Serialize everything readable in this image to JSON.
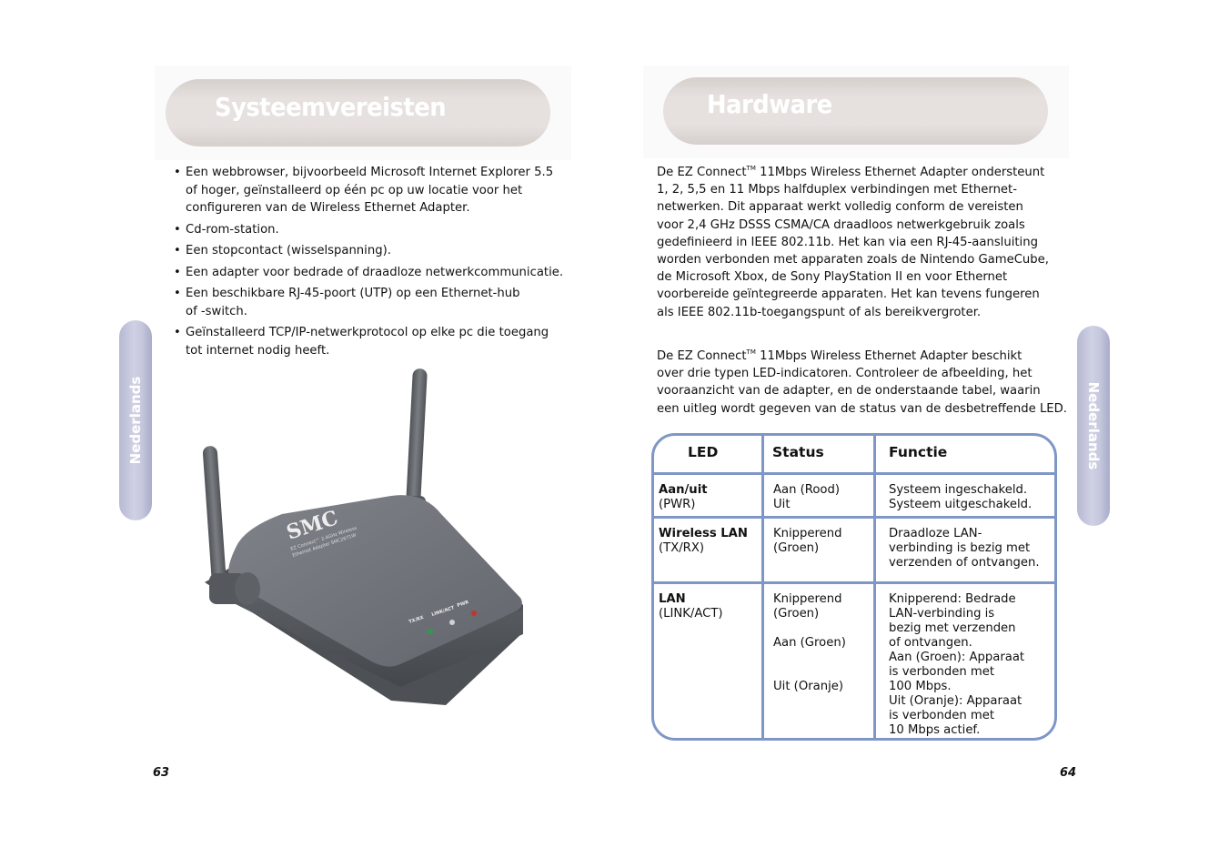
{
  "left_page": {
    "title": "Systeemvereisten",
    "side_tab": "Nederlands",
    "requirements": [
      "Een webbrowser, bijvoorbeeld Microsoft Internet Explorer 5.5 of hoger, geïnstalleerd op één pc op uw locatie voor het configureren van de Wireless Ethernet Adapter.",
      "Cd-rom-station.",
      "Een stopcontact (wisselspanning).",
      "Een adapter voor bedrade of draadloze netwerkcommunicatie.",
      "Een beschikbare RJ-45-poort (UTP) op een Ethernet-hub of -switch.",
      "Geïnstalleerd TCP/IP-netwerkprotocol op elke pc die toegang tot internet nodig heeft."
    ],
    "requirements_lines": [
      [
        "Een webbrowser, bijvoorbeeld Microsoft Internet Explorer 5.5",
        "of hoger, geïnstalleerd op één pc op uw locatie voor het",
        "configureren van de Wireless Ethernet Adapter."
      ],
      [
        "Cd-rom-station."
      ],
      [
        "Een stopcontact (wisselspanning)."
      ],
      [
        "Een adapter voor bedrade of draadloze netwerkcommunicatie."
      ],
      [
        "Een beschikbare RJ-45-poort (UTP) op een Ethernet-hub",
        "of -switch."
      ],
      [
        "Geïnstalleerd TCP/IP-netwerkprotocol op elke pc die toegang",
        "tot internet nodig heeft."
      ]
    ],
    "image": {
      "description": "SMC EZ Connect 2.4GHz Wireless Ethernet Adapter with two antennas",
      "brand": "SMC",
      "label_line1": "EZ Connect™ 2.4GHz Wireless",
      "label_line2": "Ethernet Adapter SMC2671W",
      "leds": [
        {
          "label": "TX/RX",
          "color": "#2e9a4a"
        },
        {
          "label": "LINK/ACT",
          "color": "#cfd3d6"
        },
        {
          "label": "PWR",
          "color": "#c8322a"
        }
      ]
    },
    "page_number": "63"
  },
  "right_page": {
    "title": "Hardware",
    "side_tab": "Nederlands",
    "paragraph1": {
      "prefix": "De EZ Connect",
      "tm": "TM",
      "lines": [
        " 11Mbps Wireless Ethernet Adapter ondersteunt",
        "1, 2, 5,5 en 11 Mbps halfduplex verbindingen met Ethernet-",
        "netwerken. Dit apparaat werkt volledig conform de vereisten",
        "voor 2,4 GHz DSSS CSMA/CA draadloos netwerkgebruik zoals",
        "gedefinieerd in IEEE 802.11b. Het kan via een RJ-45-aansluiting",
        "worden verbonden met apparaten zoals de Nintendo GameCube,",
        "de Microsoft Xbox, de Sony PlayStation II en voor Ethernet",
        "voorbereide geïntegreerde apparaten. Het kan tevens fungeren",
        "als IEEE 802.11b-toegangspunt of als bereikvergroter."
      ]
    },
    "paragraph2": {
      "prefix": "De EZ Connect",
      "tm": "TM",
      "lines": [
        " 11Mbps Wireless Ethernet Adapter beschikt",
        "over drie typen LED-indicatoren. Controleer de afbeelding, het",
        "vooraanzicht van de adapter, en de onderstaande tabel, waarin",
        "een uitleg wordt gegeven van de status van de desbetreffende LED."
      ]
    },
    "led_table": {
      "headers": [
        "LED",
        "Status",
        "Functie"
      ],
      "rows": [
        {
          "led_name": "Aan/uit",
          "led_code": "(PWR)",
          "status": [
            "Aan (Rood)",
            "Uit"
          ],
          "function": [
            "Systeem ingeschakeld.",
            "Systeem uitgeschakeld."
          ]
        },
        {
          "led_name": "Wireless LAN",
          "led_code": "(TX/RX)",
          "status": [
            "Knipperend",
            "(Groen)"
          ],
          "function": [
            "Draadloze LAN-",
            "verbinding is bezig met",
            "verzenden of ontvangen."
          ]
        },
        {
          "led_name": "LAN",
          "led_code": "(LINK/ACT)",
          "status_groups": [
            [
              "Knipperend",
              "(Groen)"
            ],
            [
              "Aan (Groen)"
            ],
            [
              "Uit (Oranje)"
            ]
          ],
          "function_groups": [
            [
              "Knipperend: Bedrade",
              "LAN-verbinding is",
              "bezig met verzenden",
              "of ontvangen."
            ],
            [
              "Aan (Groen): Apparaat",
              "is verbonden met",
              "100 Mbps."
            ],
            [
              "Uit (Oranje): Apparaat",
              "is verbonden met",
              "10 Mbps actief."
            ]
          ]
        }
      ],
      "border_color": "#7f97c6"
    },
    "page_number": "64"
  }
}
